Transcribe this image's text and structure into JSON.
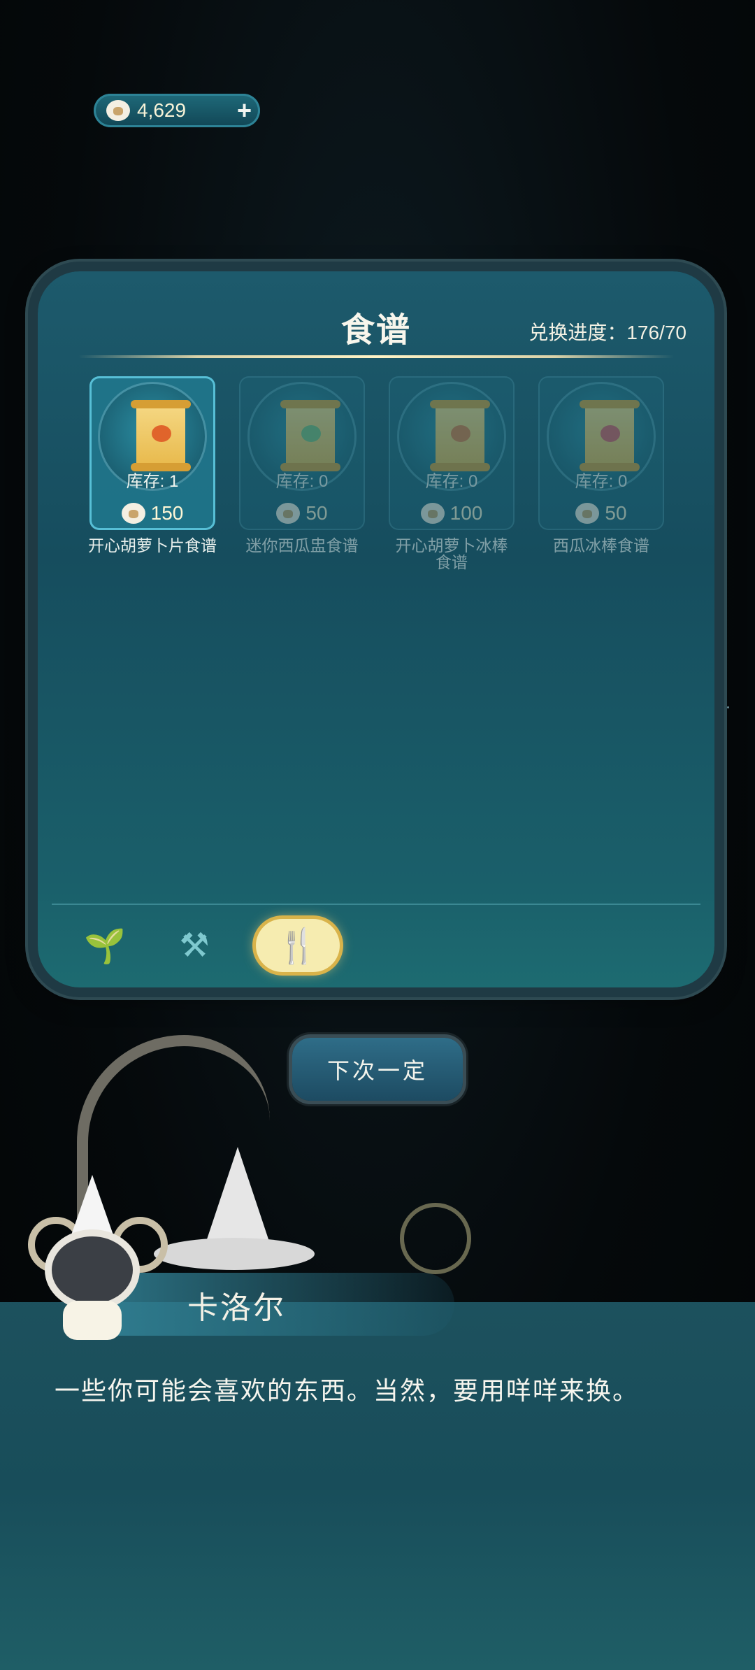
{
  "currency": {
    "value": "4,629",
    "icon": "sheep-coin-icon",
    "add_icon": "plus-icon"
  },
  "panel": {
    "title": "食谱",
    "progress": "兑换进度：176/70",
    "items": [
      {
        "name": "开心胡萝卜片食谱",
        "stock": "库存: 1",
        "price": "150",
        "food_color": "#e0642b"
      },
      {
        "name": "迷你西瓜盅食谱",
        "stock": "库存: 0",
        "price": "50",
        "food_color": "#7bbf74"
      },
      {
        "name": "开心胡萝卜冰棒食谱",
        "stock": "库存: 0",
        "price": "100",
        "food_color": "#e07a3a"
      },
      {
        "name": "西瓜冰棒食谱",
        "stock": "库存: 0",
        "price": "50",
        "food_color": "#e05a5a"
      }
    ],
    "tabs": [
      {
        "icon": "sprout-icon",
        "glyph": "🌱"
      },
      {
        "icon": "tools-icon",
        "glyph": "⚒"
      },
      {
        "icon": "recipe-utensils-icon",
        "glyph": "🍴"
      }
    ]
  },
  "next_button": "下次一定",
  "dialog": {
    "speaker": "卡洛尔",
    "text": "一些你可能会喜欢的东西。当然，要用咩咩来换。"
  },
  "colors": {
    "accent": "#f6ecb0",
    "panel": "#164d5e",
    "price": "#fff7d6"
  }
}
